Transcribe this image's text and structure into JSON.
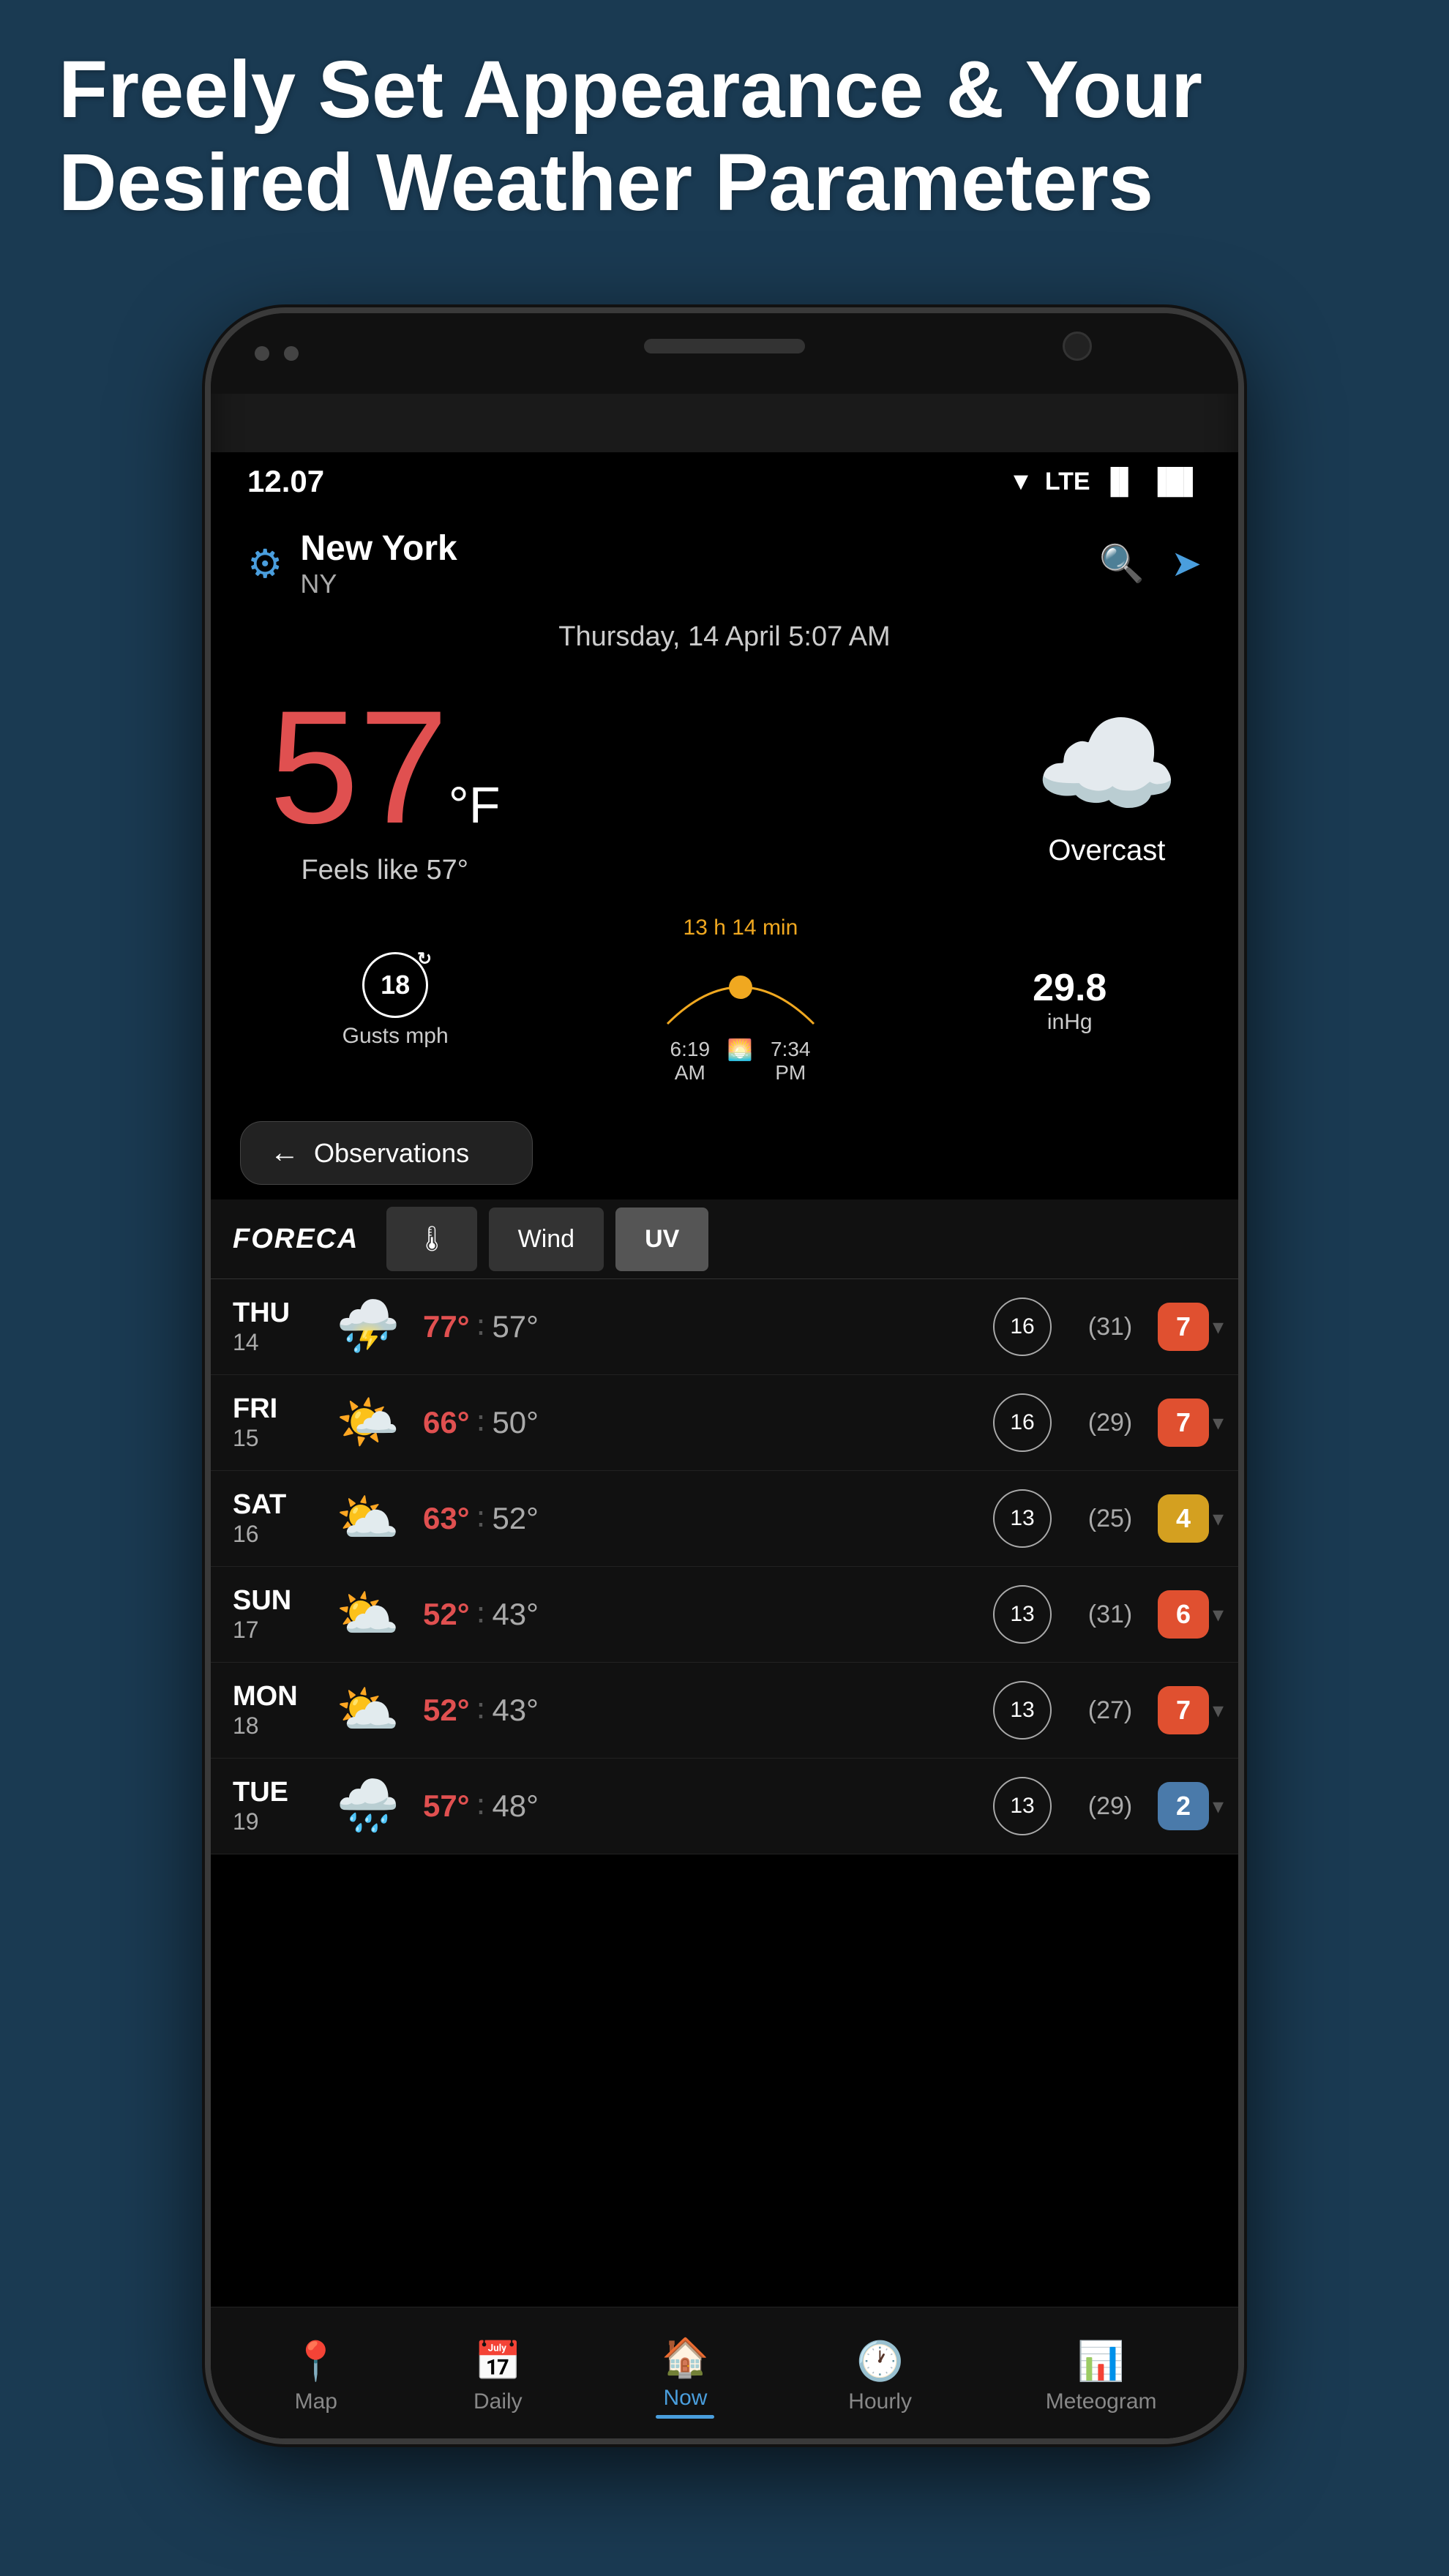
{
  "header": {
    "title": "Freely Set Appearance & Your Desired Weather Parameters"
  },
  "phone": {
    "status": {
      "time": "12.07",
      "lte": "LTE",
      "signal_bars": "▂▄█",
      "battery": "▐█▌"
    },
    "location": {
      "city": "New York",
      "state": "NY"
    },
    "date": "Thursday, 14 April 5:07 AM",
    "temperature": "57",
    "temp_unit": "°F",
    "feels_like": "Feels like 57°",
    "weather_desc": "Overcast",
    "weather_icon": "☁️",
    "gusts": {
      "value": "18",
      "label": "Gusts mph"
    },
    "sun": {
      "duration": "13 h 14 min",
      "sunrise": "6:19 AM",
      "sunset": "7:34 PM"
    },
    "pressure": {
      "value": "29.8",
      "unit": "inHg"
    },
    "obs_button": "Observations",
    "brand": "FORECA",
    "tabs": [
      "🌡",
      "Wind",
      "UV"
    ],
    "forecast": [
      {
        "day": "THU",
        "date": "14",
        "icon": "⛈️",
        "hi": "77°",
        "lo": "57°",
        "wind": "16",
        "wind_gust": "(31)",
        "uv": "7",
        "uv_color": "orange"
      },
      {
        "day": "FRI",
        "date": "15",
        "icon": "🌤️",
        "hi": "66°",
        "lo": "50°",
        "wind": "16",
        "wind_gust": "(29)",
        "uv": "7",
        "uv_color": "orange"
      },
      {
        "day": "SAT",
        "date": "16",
        "icon": "⛅",
        "hi": "63°",
        "lo": "52°",
        "wind": "13",
        "wind_gust": "(25)",
        "uv": "4",
        "uv_color": "yellow"
      },
      {
        "day": "SUN",
        "date": "17",
        "icon": "⛅",
        "hi": "52°",
        "lo": "43°",
        "wind": "13",
        "wind_gust": "(31)",
        "uv": "6",
        "uv_color": "orange"
      },
      {
        "day": "MON",
        "date": "18",
        "icon": "⛅",
        "hi": "52°",
        "lo": "43°",
        "wind": "13",
        "wind_gust": "(27)",
        "uv": "7",
        "uv_color": "orange"
      },
      {
        "day": "TUE",
        "date": "19",
        "icon": "🌧️",
        "hi": "57°",
        "lo": "48°",
        "wind": "13",
        "wind_gust": "(29)",
        "uv": "2",
        "uv_color": "blue"
      }
    ],
    "nav": [
      {
        "icon": "📍",
        "label": "Map",
        "active": false
      },
      {
        "icon": "📅",
        "label": "Daily",
        "active": false
      },
      {
        "icon": "🏠",
        "label": "Now",
        "active": true
      },
      {
        "icon": "🕐",
        "label": "Hourly",
        "active": false
      },
      {
        "icon": "📊",
        "label": "Meteogram",
        "active": false
      }
    ]
  }
}
